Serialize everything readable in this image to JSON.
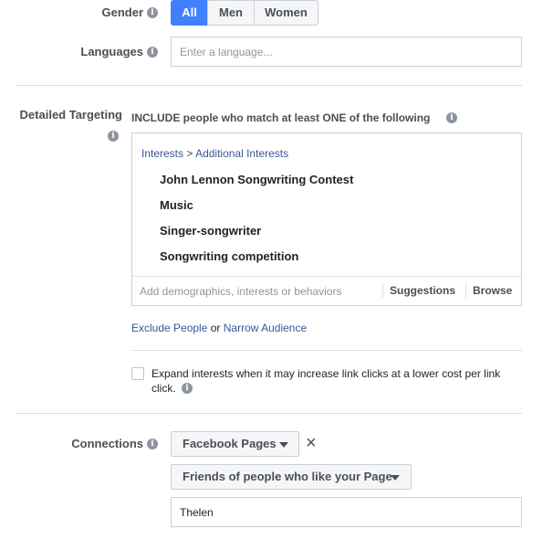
{
  "gender": {
    "label": "Gender",
    "options": [
      "All",
      "Men",
      "Women"
    ],
    "selected": "All"
  },
  "languages": {
    "label": "Languages",
    "placeholder": "Enter a language..."
  },
  "detailed_targeting": {
    "label": "Detailed Targeting",
    "include_text": "INCLUDE people who match at least ONE of the following",
    "breadcrumb_root": "Interests",
    "breadcrumb_sep": ">",
    "breadcrumb_child": "Additional Interests",
    "interests": [
      "John Lennon Songwriting Contest",
      "Music",
      "Singer-songwriter",
      "Songwriting competition"
    ],
    "search_placeholder": "Add demographics, interests or behaviors",
    "suggestions_label": "Suggestions",
    "browse_label": "Browse",
    "exclude_label": "Exclude People",
    "or_text": "or",
    "narrow_label": "Narrow Audience",
    "expand_text_line1": "Expand interests when it may increase link clicks at a lower cost per link",
    "expand_text_line2": "click."
  },
  "connections": {
    "label": "Connections",
    "type_select": "Facebook Pages",
    "remove_icon": "×",
    "subtype_select": "Friends of people who like your Page",
    "page_input_value": "Thelen"
  },
  "icons": {
    "info": "i"
  }
}
